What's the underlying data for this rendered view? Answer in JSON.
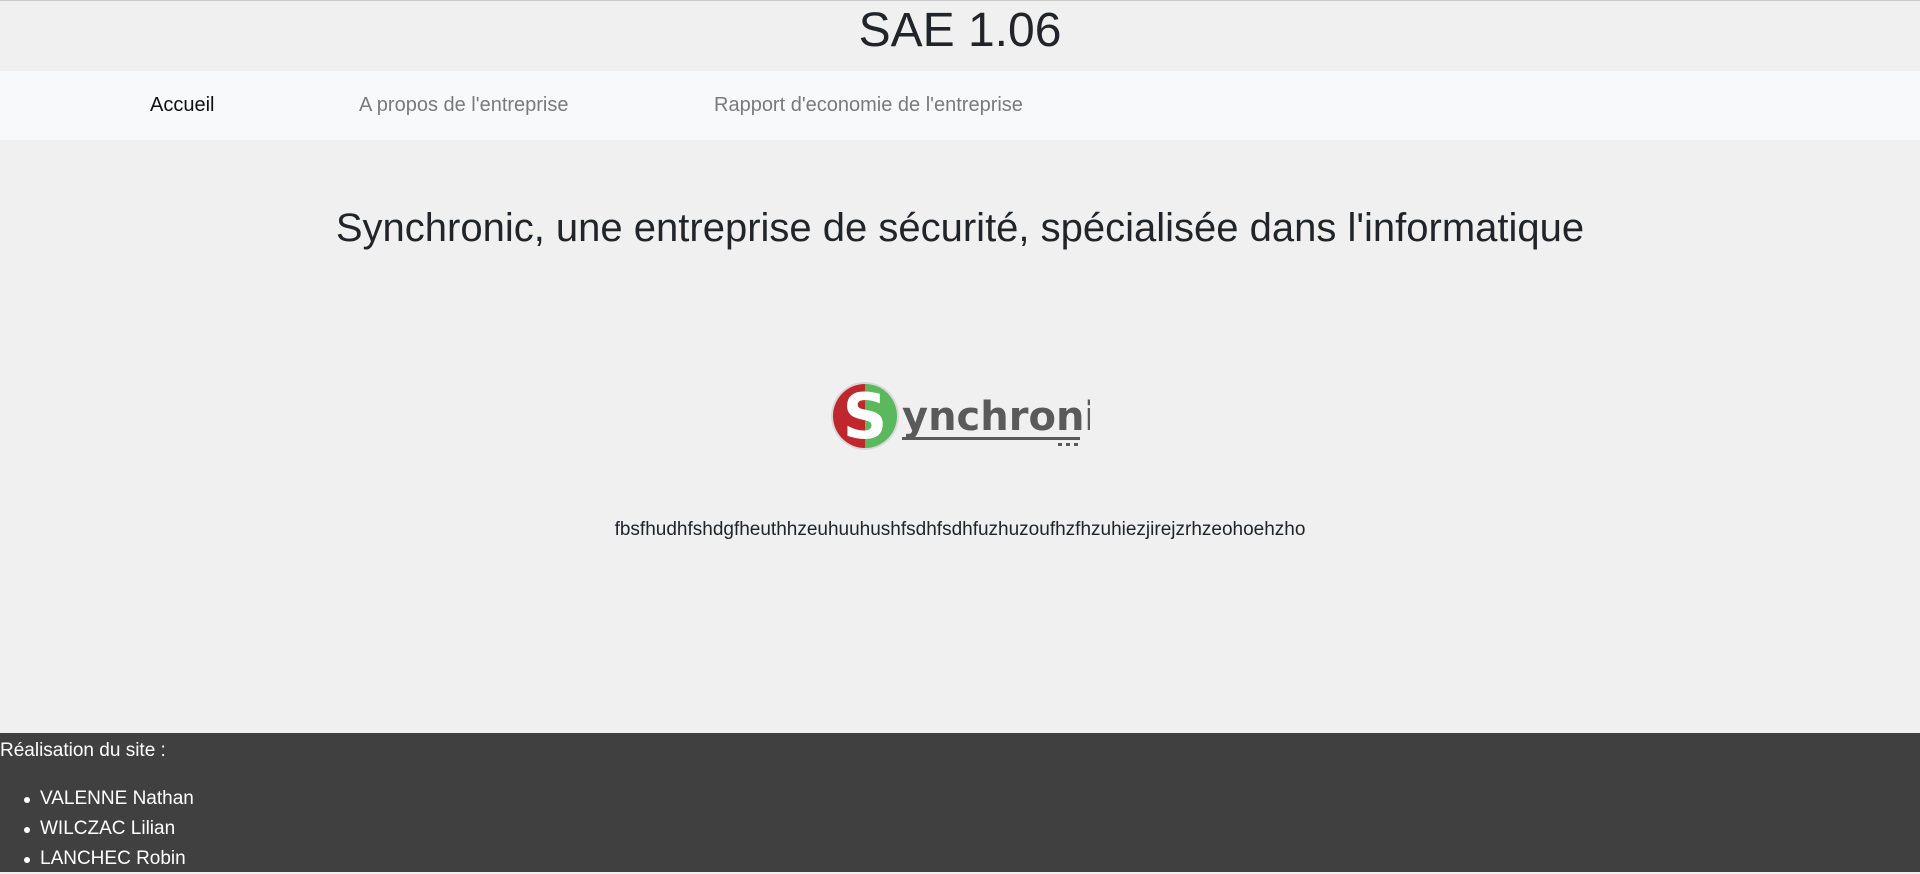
{
  "header": {
    "title": "SAE 1.06"
  },
  "nav": {
    "items": [
      {
        "label": "Accueil"
      },
      {
        "label": "A propos de l'entreprise"
      },
      {
        "label": "Rapport d'economie de l'entreprise"
      }
    ]
  },
  "main": {
    "headline": "Synchronic, une entreprise de sécurité, spécialisée dans l'informatique",
    "logo": {
      "letter": "S",
      "text": "ynchronic",
      "colors": {
        "red": "#c0272d",
        "green": "#5cb85c",
        "text": "#5a5a5a"
      }
    },
    "description": "fbsfhudhfshdgfheuthhzeuhuuhushfsdhfsdhfuzhuzoufhzfhzuhiezjirejzrhzeohoehzho"
  },
  "footer": {
    "heading": "Réalisation du site :",
    "authors": [
      "VALENNE Nathan",
      "WILCZAC Lilian",
      "LANCHEC Robin"
    ]
  }
}
